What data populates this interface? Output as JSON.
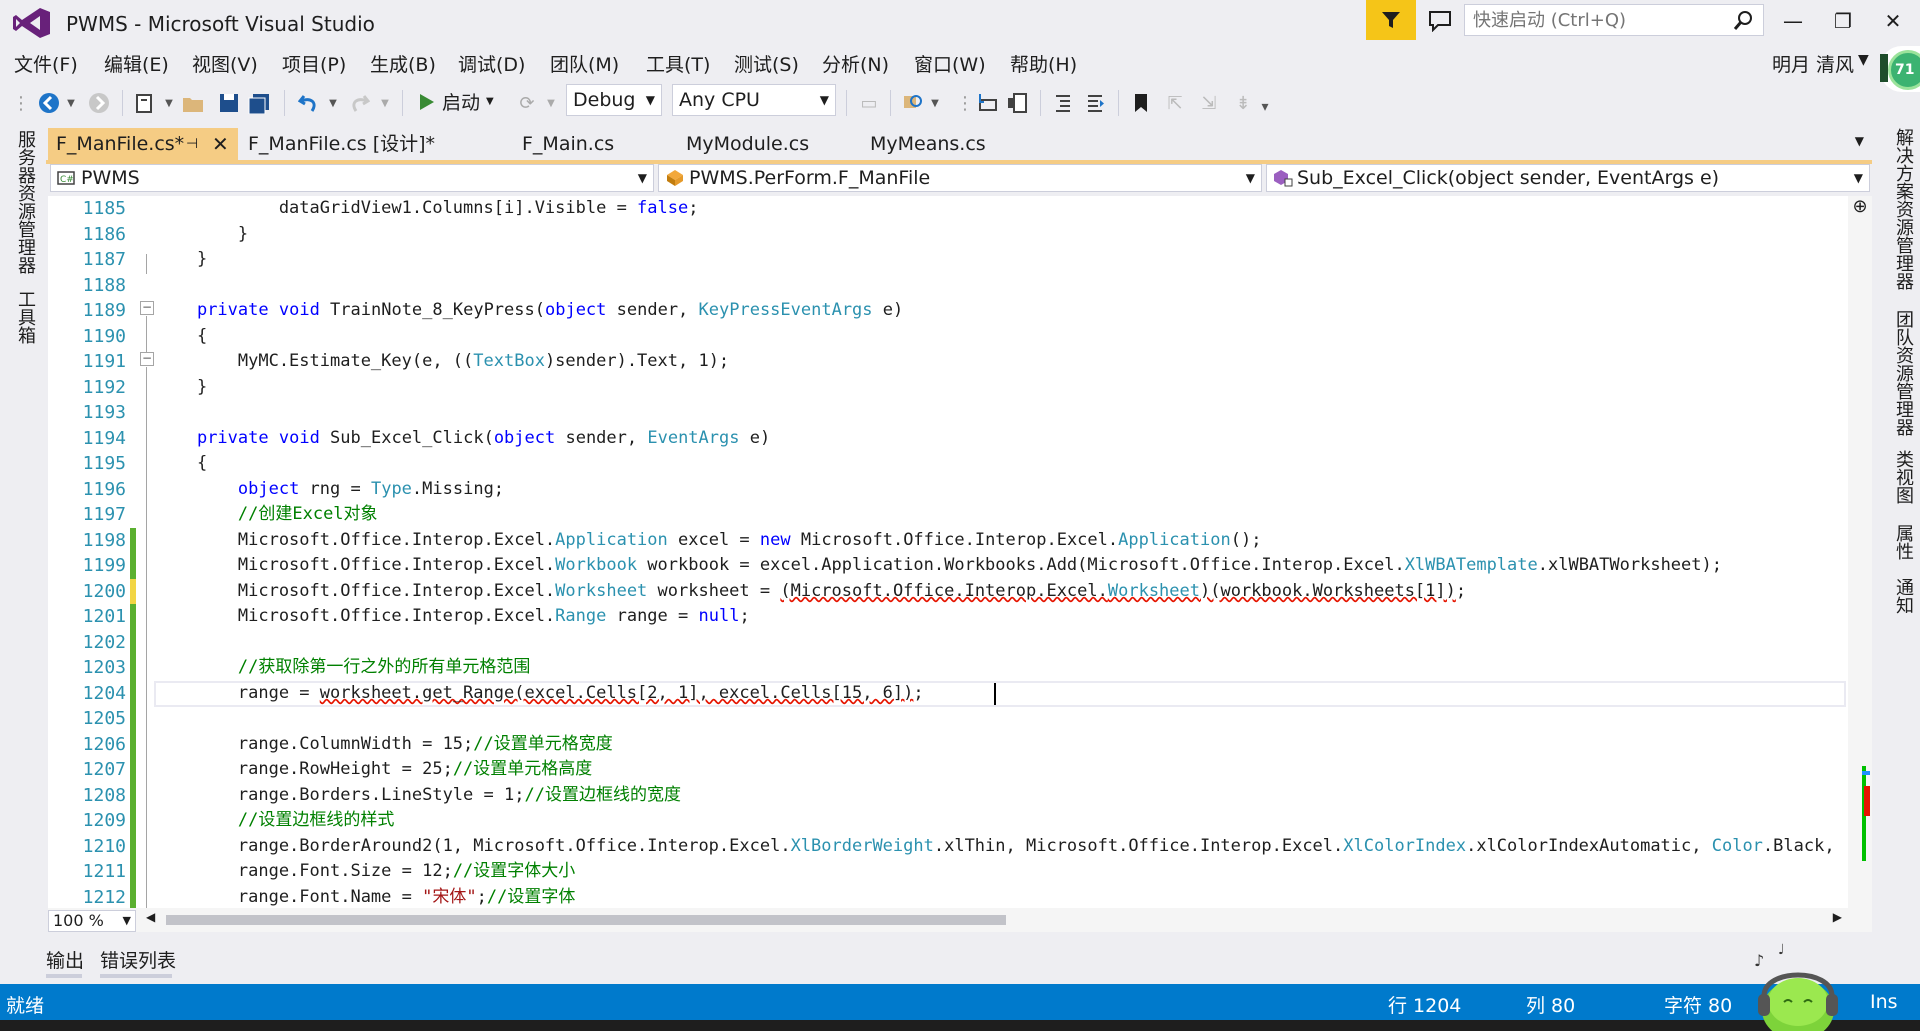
{
  "window": {
    "title": "PWMS - Microsoft Visual Studio",
    "quick_launch_placeholder": "快速启动 (Ctrl+Q)",
    "minimize": "—",
    "restore": "❐",
    "close": "✕"
  },
  "menu": {
    "items": [
      "文件(F)",
      "编辑(E)",
      "视图(V)",
      "项目(P)",
      "生成(B)",
      "调试(D)",
      "团队(M)",
      "工具(T)",
      "测试(S)",
      "分析(N)",
      "窗口(W)",
      "帮助(H)"
    ],
    "user": "明月 清风",
    "badge": "71"
  },
  "toolbar": {
    "start_label": "启动",
    "config": "Debug",
    "platform": "Any CPU"
  },
  "left_tabs": [
    "服务器资源管理器",
    "工具箱"
  ],
  "right_tabs": [
    "解决方案资源管理器",
    "团队资源管理器",
    "类视图",
    "属性",
    "通知"
  ],
  "doc_tabs": [
    "F_ManFile.cs*",
    "F_ManFile.cs [设计]*",
    "F_Main.cs",
    "MyModule.cs",
    "MyMeans.cs"
  ],
  "nav": {
    "project": "PWMS",
    "type": "PWMS.PerForm.F_ManFile",
    "member": "Sub_Excel_Click(object sender, EventArgs e)"
  },
  "editor": {
    "line_numbers": [
      "1185",
      "1186",
      "1187",
      "1188",
      "1189",
      "1190",
      "1191",
      "1192",
      "1193",
      "1194",
      "1195",
      "1196",
      "1197",
      "1198",
      "1199",
      "1200",
      "1201",
      "1202",
      "1203",
      "1204",
      "1205",
      "1206",
      "1207",
      "1208",
      "1209",
      "1210",
      "1211",
      "1212"
    ],
    "current_line": "1204",
    "zoom": "100 %"
  },
  "bottom_tabs": [
    "输出",
    "错误列表"
  ],
  "status": {
    "state": "就绪",
    "line": "行 1204",
    "col": "列 80",
    "ch": "字符 80",
    "mode": "Ins"
  },
  "colors": {
    "accent": "#007ACC",
    "active_tab": "#F5CC84",
    "keyword": "#0000FF",
    "type": "#2B91AF",
    "comment": "#008000",
    "string": "#A31515"
  }
}
